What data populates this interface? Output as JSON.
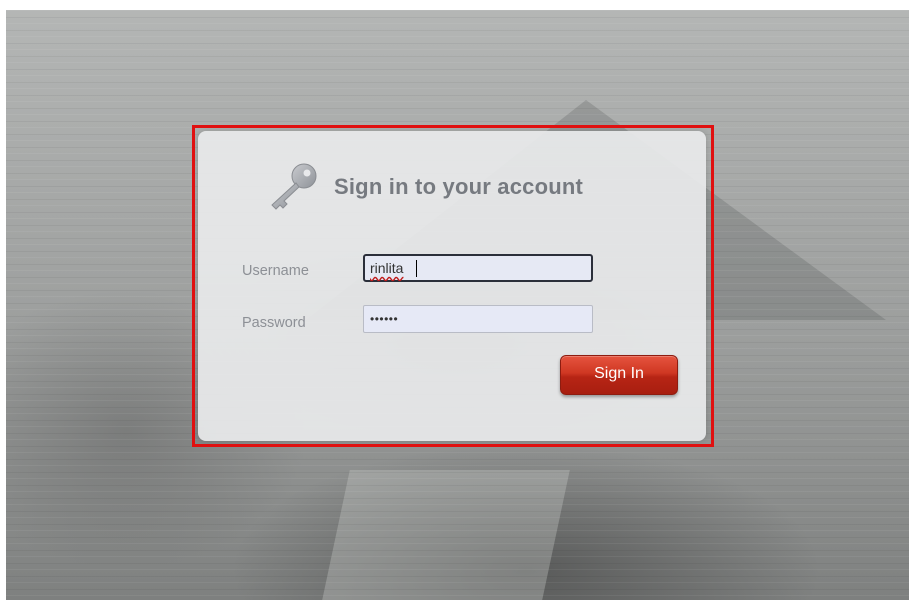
{
  "login": {
    "title": "Sign in to your account",
    "username_label": "Username",
    "username_value": "rinlita",
    "password_label": "Password",
    "password_value": "••••••",
    "signin_label": "Sign In",
    "icon": "key-icon"
  },
  "colors": {
    "highlight_border": "#e01010",
    "button_red": "#c43220",
    "title_gray": "#767a80"
  }
}
